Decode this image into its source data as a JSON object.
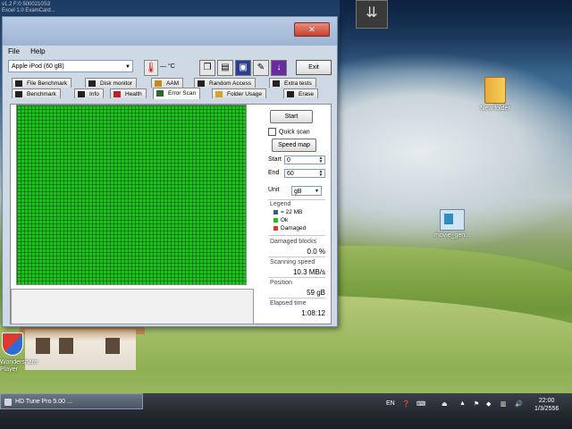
{
  "overlay": {
    "line1": "v1.2 F:0   5000210S3",
    "line2": "Excel 1.0    ExamCard..."
  },
  "desktop_icons": [
    {
      "name": "folder-icon",
      "label": "New folder"
    },
    {
      "name": "file-icon",
      "label": "movie_gen..."
    }
  ],
  "shield_label": "Wondershare\nPlayer",
  "window": {
    "menu": [
      "File",
      "Help"
    ],
    "drive": "Apple  iPod          (60 gB)",
    "temp": "— °C",
    "exit_label": "Exit",
    "tabs_row1": [
      "File Benchmark",
      "Disk monitor",
      "AAM",
      "Random Access",
      "Extra tests"
    ],
    "tabs_row2": [
      "Benchmark",
      "Info",
      "Health",
      "Error Scan",
      "Folder Usage",
      "Erase"
    ],
    "active_tab": "Error Scan"
  },
  "panel": {
    "start_label": "Start",
    "quick_scan_label": "Quick scan",
    "quick_scan_checked": false,
    "speed_map_label": "Speed map",
    "start_field_label": "Start",
    "start_value": "0",
    "end_field_label": "End",
    "end_value": "60",
    "unit_label": "Unit",
    "unit_value": "gB",
    "legend_title": "Legend",
    "legend": [
      {
        "label": "= 22 MB",
        "color": "#3a5a8a"
      },
      {
        "label": "Ok",
        "color": "#1fc21f"
      },
      {
        "label": "Damaged",
        "color": "#d93a2a"
      }
    ],
    "damaged_label": "Damaged blocks",
    "damaged_value": "0.0 %",
    "speed_label": "Scanning speed",
    "speed_value": "10.3 MB/s",
    "position_label": "Position",
    "position_value": "59 gB",
    "elapsed_label": "Elapsed time",
    "elapsed_value": "1:08:12",
    "grid_color": "#1fc21f"
  },
  "taskbar": {
    "app_label": "HD Tune Pro 5.00 ...",
    "lang": "EN",
    "time": "22:00",
    "date": "1/3/2556"
  }
}
